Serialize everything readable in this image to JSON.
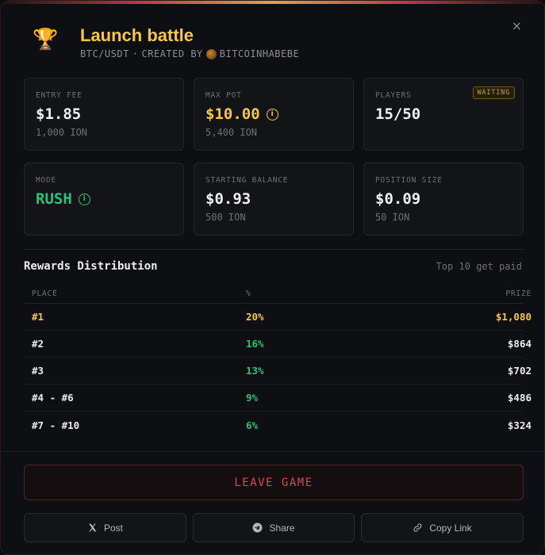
{
  "header": {
    "title": "Launch battle",
    "pair": "BTC/USDT",
    "separator": "·",
    "created_by_label": "CREATED BY",
    "creator": "BITCOINHABEBE",
    "close_glyph": "×",
    "trophy_glyph": "🏆"
  },
  "stats": {
    "entry_fee": {
      "label": "ENTRY FEE",
      "value": "$1.85",
      "sub": "1,000 ION"
    },
    "max_pot": {
      "label": "MAX POT",
      "value": "$10.00",
      "sub": "5,400 ION"
    },
    "players": {
      "label": "PLAYERS",
      "value": "15/50",
      "badge": "WAITING"
    },
    "mode": {
      "label": "MODE",
      "value": "RUSH"
    },
    "starting_balance": {
      "label": "STARTING BALANCE",
      "value": "$0.93",
      "sub": "500 ION"
    },
    "position_size": {
      "label": "POSITION SIZE",
      "value": "$0.09",
      "sub": "50 ION"
    }
  },
  "rewards": {
    "title": "Rewards Distribution",
    "note": "Top 10 get paid",
    "columns": {
      "place": "PLACE",
      "pct": "%",
      "prize": "PRIZE"
    },
    "rows": [
      {
        "place": "#1",
        "pct": "20%",
        "prize": "$1,080"
      },
      {
        "place": "#2",
        "pct": "16%",
        "prize": "$864"
      },
      {
        "place": "#3",
        "pct": "13%",
        "prize": "$702"
      },
      {
        "place": "#4 - #6",
        "pct": "9%",
        "prize": "$486"
      },
      {
        "place": "#7 - #10",
        "pct": "6%",
        "prize": "$324"
      }
    ]
  },
  "actions": {
    "leave": "LEAVE GAME",
    "post": "Post",
    "share": "Share",
    "copy_link": "Copy Link"
  },
  "colors": {
    "accent_gold": "#f7c64a",
    "accent_green": "#2fbf7a",
    "danger": "#e0434f"
  }
}
